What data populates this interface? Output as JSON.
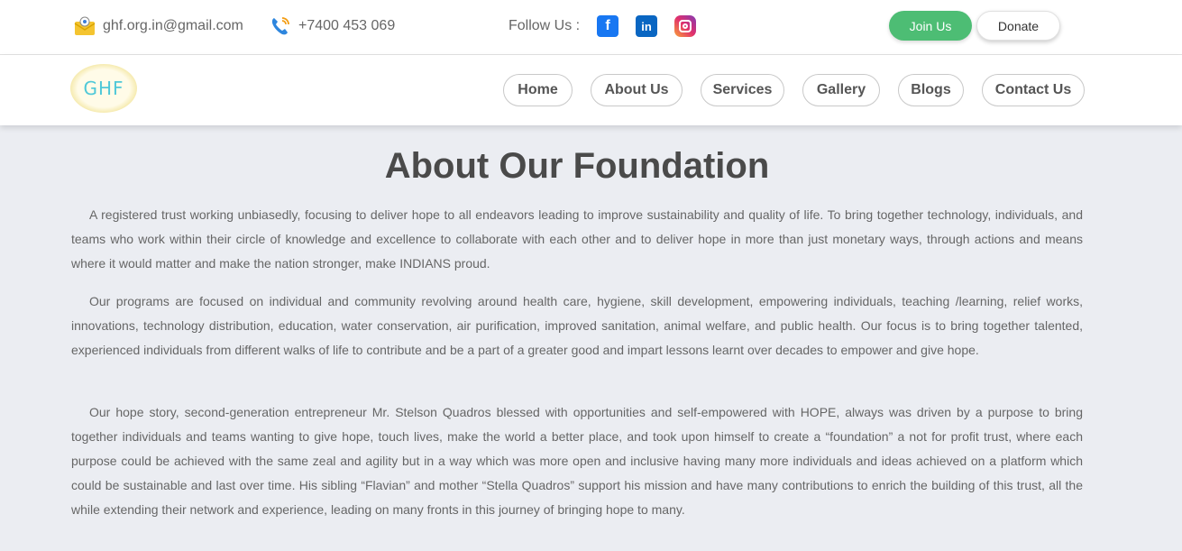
{
  "topbar": {
    "email": "ghf.org.in@gmail.com",
    "phone": "+7400 453 069",
    "follow_label": "Follow Us :",
    "join_label": "Join Us",
    "donate_label": "Donate"
  },
  "logo": {
    "text": "GHF"
  },
  "nav": {
    "items": [
      {
        "label": "Home"
      },
      {
        "label": "About Us"
      },
      {
        "label": "Services"
      },
      {
        "label": "Gallery"
      },
      {
        "label": "Blogs"
      },
      {
        "label": "Contact Us"
      }
    ]
  },
  "main": {
    "title": "About Our Foundation",
    "paragraphs": [
      "A registered trust working unbiasedly, focusing to deliver hope to all endeavors leading to improve sustainability and quality of life. To bring together technology, individuals, and teams who work within their circle of knowledge and excellence to collaborate with each other and to deliver hope in more than just monetary ways, through actions and means where it would matter and make the nation stronger, make INDIANS proud.",
      "Our programs are focused on individual and community revolving around health care, hygiene, skill development, empowering individuals, teaching /learning, relief works, innovations, technology distribution, education, water conservation, air purification, improved sanitation, animal welfare, and public health. Our focus is to bring together talented, experienced individuals from different walks of life to contribute and be a part of a greater good and impart lessons learnt over decades to empower and give hope.",
      "Our hope story, second-generation entrepreneur Mr. Stelson Quadros blessed with opportunities and self-empowered with HOPE, always was driven by a purpose to bring together individuals and teams wanting to give hope, touch lives, make the world a better place, and took upon himself to create a “foundation” a not for profit trust, where each purpose could be achieved with the same zeal and agility but in a way which was more open and inclusive having many more individuals and ideas achieved on a platform which could be sustainable and last over time. His sibling “Flavian” and mother “Stella Quadros” support his mission and have many contributions to enrich the building of this trust, all the while extending their network and experience, leading on many fronts in this journey of bringing hope to many."
    ]
  },
  "colors": {
    "accent_green": "#4dbd74",
    "page_background": "#ebedf2",
    "facebook": "#1877f2",
    "linkedin": "#0a66c2"
  },
  "icons": [
    "email-icon",
    "phone-icon",
    "facebook-icon",
    "linkedin-icon",
    "instagram-icon"
  ]
}
